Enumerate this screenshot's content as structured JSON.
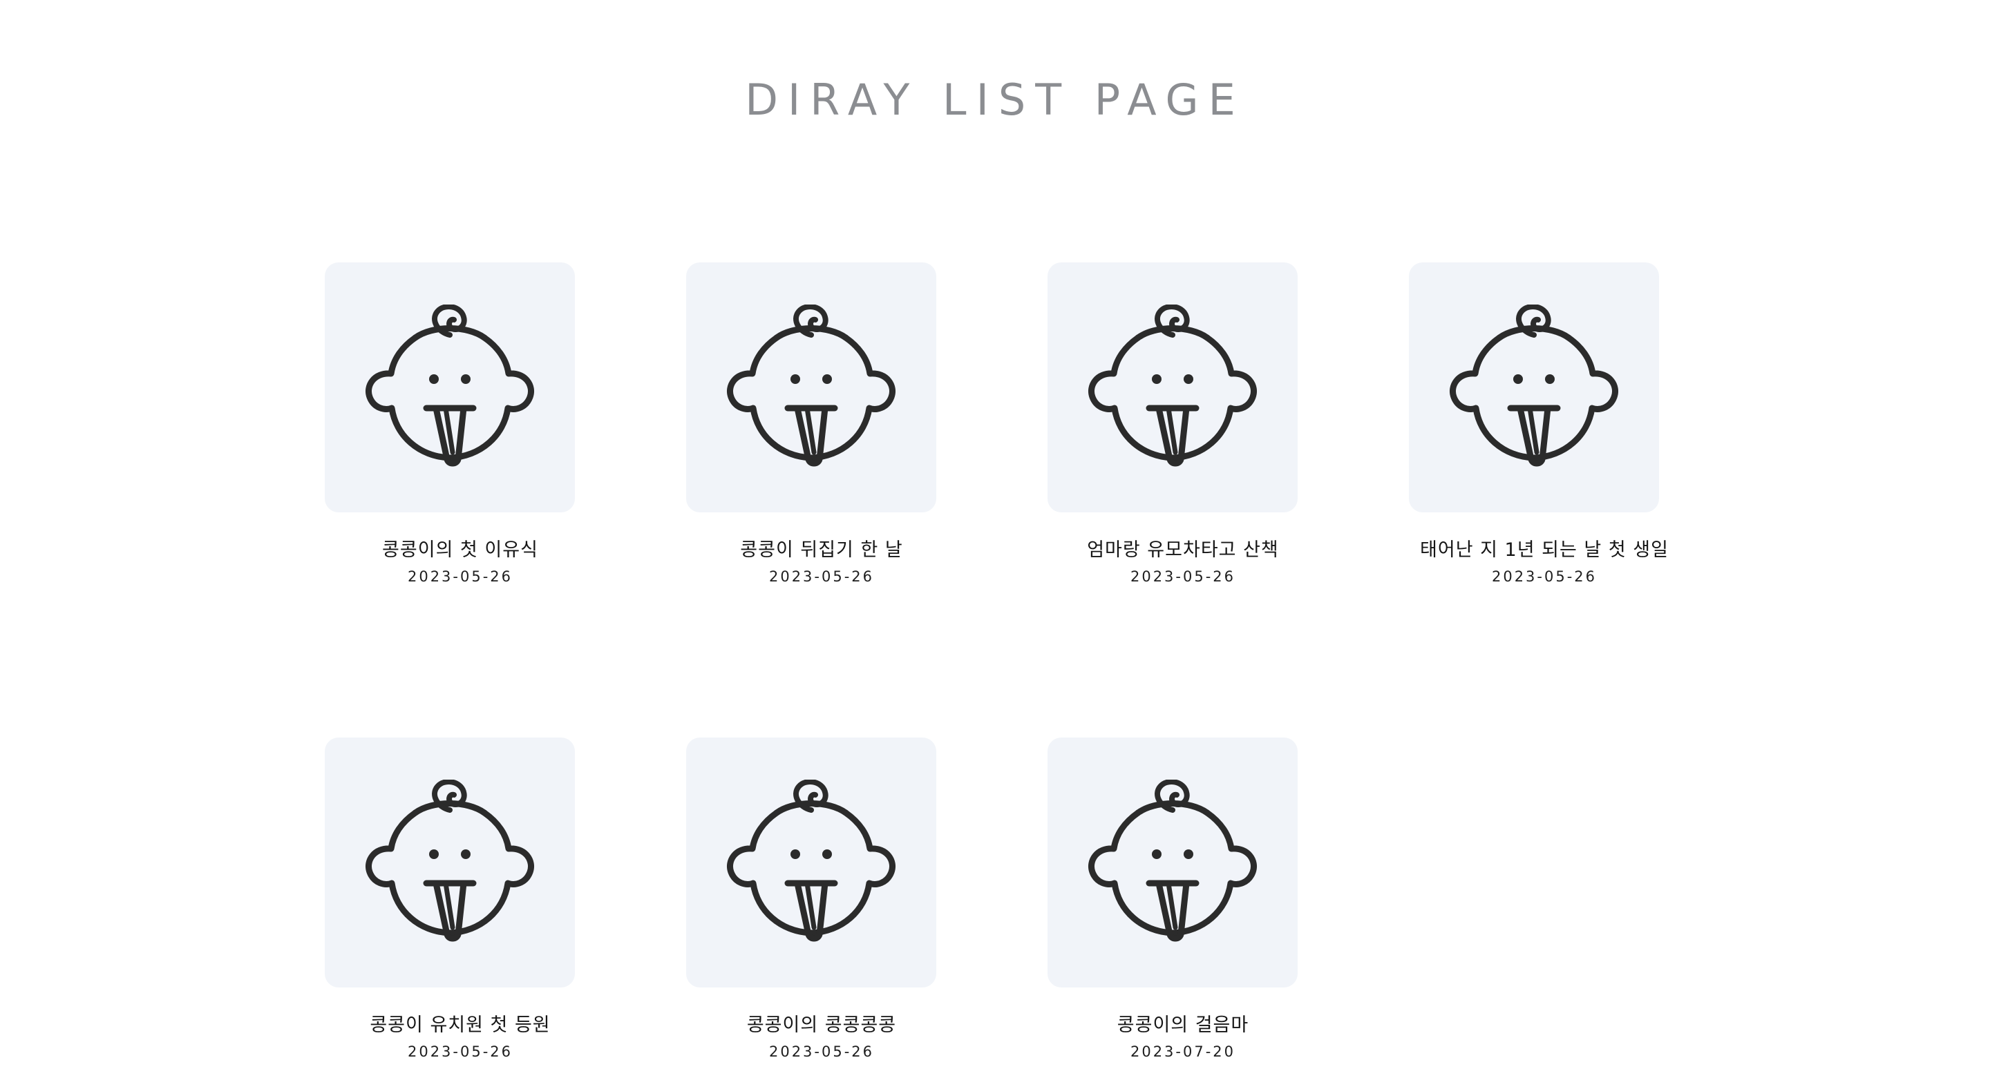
{
  "page": {
    "title": "DIRAY LIST PAGE"
  },
  "diaries": [
    {
      "title": "콩콩이의 첫 이유식",
      "date": "2023-05-26",
      "icon": "baby-icon"
    },
    {
      "title": "콩콩이 뒤집기 한 날",
      "date": "2023-05-26",
      "icon": "baby-icon"
    },
    {
      "title": "엄마랑 유모차타고 산책",
      "date": "2023-05-26",
      "icon": "baby-icon"
    },
    {
      "title": "태어난 지 1년 되는 날 첫 생일",
      "date": "2023-05-26",
      "icon": "baby-icon"
    },
    {
      "title": "콩콩이 유치원 첫 등원",
      "date": "2023-05-26",
      "icon": "baby-icon"
    },
    {
      "title": "콩콩이의 콩콩콩콩",
      "date": "2023-05-26",
      "icon": "baby-icon"
    },
    {
      "title": "콩콩이의 걸음마",
      "date": "2023-07-20",
      "icon": "baby-icon"
    }
  ],
  "colors": {
    "title": "#8b8d91",
    "thumb_bg": "#f1f4f9",
    "icon_stroke": "#2b2b2b"
  }
}
